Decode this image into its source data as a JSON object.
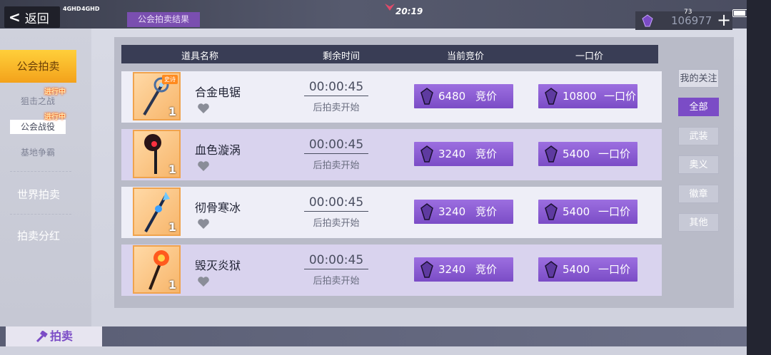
{
  "topbar": {
    "back_label": "返回",
    "signal_left": "4GHD",
    "signal_right": "4GHD",
    "clock": "20:19",
    "result_tag": "公会拍卖结果",
    "currency_amount": "106977",
    "battery_pct": "73"
  },
  "sidebar": {
    "guild_auction": "公会拍卖",
    "sub_items": [
      {
        "label": "狙击之战",
        "badge": "进行中"
      },
      {
        "label": "公会战役",
        "badge": "进行中"
      },
      {
        "label": "基地争霸",
        "badge": ""
      }
    ],
    "world_auction": "世界拍卖",
    "auction_dividend": "拍卖分红"
  },
  "table": {
    "headers": [
      "道具名称",
      "剩余时间",
      "当前竞价",
      "一口价"
    ],
    "rows": [
      {
        "name": "合金电锯",
        "qty": "1",
        "epic": "史诗",
        "timer": "00:00:45",
        "timer_sub": "后拍卖开始",
        "bid_amount": "6480",
        "bid_label": "竞价",
        "buyout_amount": "10800",
        "buyout_label": "一口价"
      },
      {
        "name": "血色漩涡",
        "qty": "1",
        "epic": "",
        "timer": "00:00:45",
        "timer_sub": "后拍卖开始",
        "bid_amount": "3240",
        "bid_label": "竞价",
        "buyout_amount": "5400",
        "buyout_label": "一口价"
      },
      {
        "name": "彻骨寒冰",
        "qty": "1",
        "epic": "",
        "timer": "00:00:45",
        "timer_sub": "后拍卖开始",
        "bid_amount": "3240",
        "bid_label": "竞价",
        "buyout_amount": "5400",
        "buyout_label": "一口价"
      },
      {
        "name": "毁灭炎狱",
        "qty": "1",
        "epic": "",
        "timer": "00:00:45",
        "timer_sub": "后拍卖开始",
        "bid_amount": "3240",
        "bid_label": "竞价",
        "buyout_amount": "5400",
        "buyout_label": "一口价"
      }
    ]
  },
  "filters": [
    "我的关注",
    "全部",
    "武装",
    "奥义",
    "徽章",
    "其他"
  ],
  "bottom": {
    "auction_tab": "拍卖"
  },
  "colors": {
    "accent_purple": "#7b4cc6",
    "active_gold": "#f3a21b",
    "header_navy": "#393d55"
  }
}
